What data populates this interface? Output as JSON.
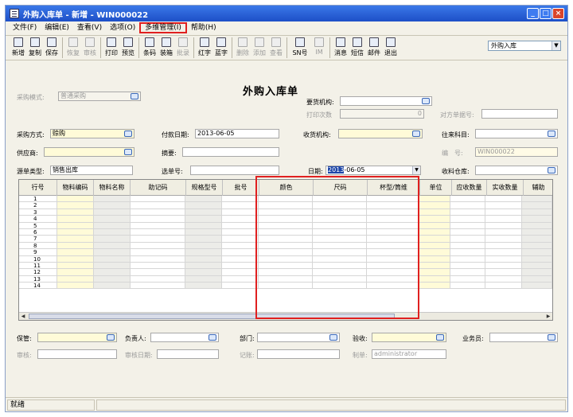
{
  "window": {
    "title": "外购入库单 - 新增 - WIN000022"
  },
  "menu": [
    "文件(F)",
    "编辑(E)",
    "查看(V)",
    "选项(O)",
    "多维管理(I)",
    "帮助(H)"
  ],
  "toolbar": [
    {
      "label": "新增",
      "icon": "new-doc-icon",
      "disabled": false
    },
    {
      "label": "复制",
      "icon": "copy-icon",
      "disabled": false
    },
    {
      "label": "保存",
      "icon": "save-icon",
      "disabled": false
    },
    {
      "label": "恢复",
      "icon": "undo-icon",
      "disabled": true
    },
    {
      "label": "审核",
      "icon": "approve-icon",
      "disabled": true
    },
    {
      "label": "打印",
      "icon": "print-icon",
      "disabled": false
    },
    {
      "label": "预览",
      "icon": "preview-icon",
      "disabled": false
    },
    {
      "label": "条码",
      "icon": "barcode-icon",
      "disabled": false
    },
    {
      "label": "装箱",
      "icon": "box-icon",
      "disabled": false
    },
    {
      "label": "批录",
      "icon": "batch-icon",
      "disabled": true
    },
    {
      "label": "红字",
      "icon": "red-icon",
      "disabled": false
    },
    {
      "label": "蓝字",
      "icon": "blue-icon",
      "disabled": false
    },
    {
      "label": "删除",
      "icon": "delete-icon",
      "disabled": true
    },
    {
      "label": "添加",
      "icon": "add-icon",
      "disabled": true
    },
    {
      "label": "查看",
      "icon": "view-icon",
      "disabled": true
    },
    {
      "label": "SN号",
      "icon": "sn-icon",
      "disabled": false
    },
    {
      "label": "IM",
      "icon": "im-icon",
      "disabled": true
    },
    {
      "label": "消息",
      "icon": "message-icon",
      "disabled": false
    },
    {
      "label": "短信",
      "icon": "sms-icon",
      "disabled": false
    },
    {
      "label": "邮件",
      "icon": "mail-icon",
      "disabled": false
    },
    {
      "label": "退出",
      "icon": "exit-icon",
      "disabled": false
    }
  ],
  "toolbar_select": "外购入库",
  "form": {
    "title": "外购入库单",
    "purchase_mode_label": "采购模式:",
    "purchase_mode_value": "普通采购",
    "req_org_label": "要货机构:",
    "req_org_value": "",
    "print_count_label": "打印次数",
    "print_count_value": "0",
    "counter_no_label": "对方单据号:",
    "counter_no_value": "",
    "purchase_method_label": "采购方式:",
    "purchase_method_value": "赊购",
    "pay_date_label": "付款日期:",
    "pay_date_value": "2013-06-05",
    "recv_org_label": "收货机构:",
    "recv_org_value": "",
    "account_label": "往来科目:",
    "account_value": "",
    "supplier_label": "供应商:",
    "supplier_value": "",
    "summary_label": "摘要:",
    "summary_value": "",
    "number_label": "编　号:",
    "number_value": "WIN000022",
    "source_type_label": "源单类型:",
    "source_type_value": "销售出库",
    "source_no_label": "选单号:",
    "source_no_value": "",
    "date_label": "日期:",
    "date_sel": "2013",
    "date_rest": "-06-05",
    "warehouse_label": "收料仓库:",
    "warehouse_value": "",
    "keeper_label": "保管:",
    "keeper_value": "",
    "manager_label": "负责人:",
    "manager_value": "",
    "dept_label": "部门:",
    "dept_value": "",
    "accept_label": "验收:",
    "accept_value": "",
    "clerk_label": "业务员:",
    "clerk_value": "",
    "audit_label": "审核:",
    "audit_value": "",
    "audit_date_label": "审核日期:",
    "audit_date_value": "",
    "posting_label": "记账:",
    "posting_value": "",
    "maker_label": "制单:",
    "maker_value": "administrator"
  },
  "grid": {
    "columns": [
      "行号",
      "物料编码",
      "物料名称",
      "助记码",
      "规格型号",
      "批号",
      "颜色",
      "尺码",
      "杯型/筒维",
      "单位",
      "应收数量",
      "实收数量",
      "辅助"
    ],
    "rows": [
      "1",
      "2",
      "3",
      "4",
      "5",
      "6",
      "7",
      "8",
      "9",
      "10",
      "11",
      "12",
      "13",
      "14"
    ]
  },
  "status": {
    "text": "就绪"
  }
}
